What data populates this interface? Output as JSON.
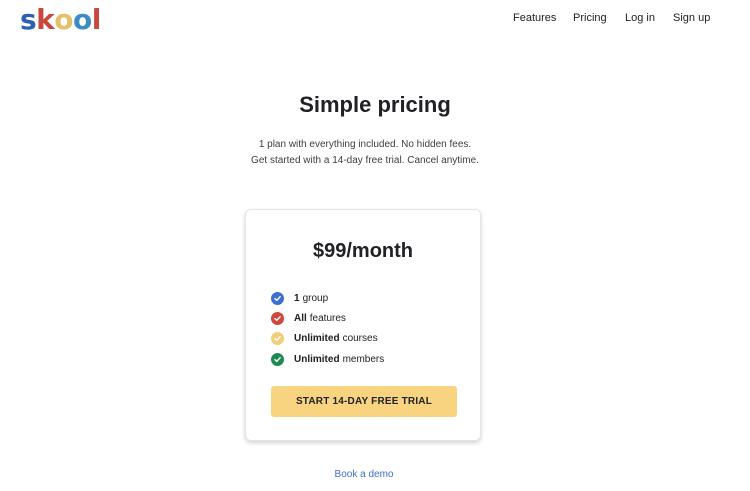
{
  "logo": {
    "letters": [
      "s",
      "k",
      "o",
      "o",
      "l"
    ],
    "colors": [
      "#2f5fb4",
      "#c9483d",
      "#e5c06b",
      "#3d8bc4",
      "#c9483d"
    ]
  },
  "nav": {
    "features": "Features",
    "pricing": "Pricing",
    "login": "Log in",
    "signup": "Sign up"
  },
  "hero": {
    "title": "Simple pricing",
    "subtitle_line1": "1 plan with everything included. No hidden fees.",
    "subtitle_line2": "Get started with a 14-day free trial. Cancel anytime."
  },
  "plan": {
    "price": "$99/month",
    "features": [
      {
        "bold": "1",
        "text": "group",
        "icon": "check-circle-icon",
        "color": "#3b6fd1"
      },
      {
        "bold": "All",
        "text": "features",
        "icon": "check-circle-icon",
        "color": "#d2463c"
      },
      {
        "bold": "Unlimited",
        "text": "courses",
        "icon": "check-circle-icon",
        "color": "#f3ce79"
      },
      {
        "bold": "Unlimited",
        "text": "members",
        "icon": "check-circle-icon",
        "color": "#1f8a4f"
      }
    ],
    "cta_label": "START 14-DAY FREE TRIAL",
    "cta_color": "#f8d481"
  },
  "footer": {
    "demo_link": "Book a demo"
  }
}
